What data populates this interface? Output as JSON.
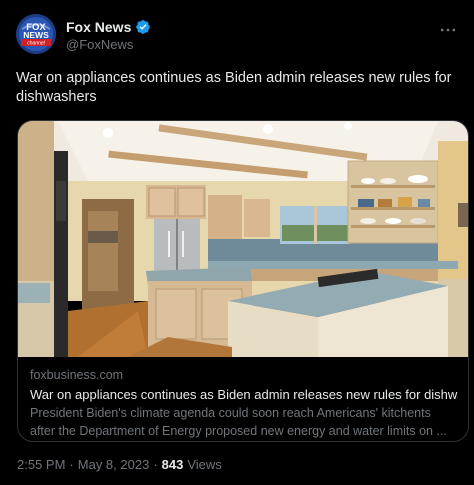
{
  "author": {
    "display_name": "Fox News",
    "handle": "@FoxNews",
    "verified": true,
    "avatar_logo_text": [
      "FOX",
      "NEWS",
      "channel"
    ]
  },
  "tweet": {
    "text": "War on appliances continues as Biden admin releases new rules for dishwashers"
  },
  "link_card": {
    "domain": "foxbusiness.com",
    "title": "War on appliances continues as Biden admin releases new rules for dishwas...",
    "description": "President Biden's climate agenda could soon reach Americans' kitchents after the Department of Energy proposed new energy and water limits on ..."
  },
  "meta": {
    "time": "2:55 PM",
    "date": "May 8, 2023",
    "separator": "·",
    "views_count": "843",
    "views_label": "Views"
  },
  "colors": {
    "background": "#000000",
    "primary_text": "#e7e9ea",
    "secondary_text": "#71767b",
    "border": "#2f3336",
    "verified_badge": "#1d9bf0"
  },
  "icons": {
    "verified": "verified-badge-icon",
    "more": "more-options-icon"
  }
}
